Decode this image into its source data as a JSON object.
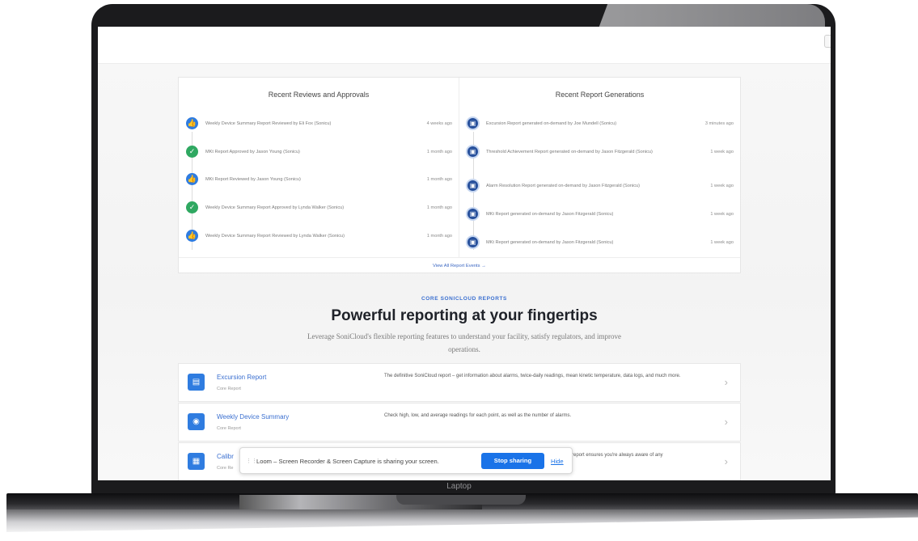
{
  "device": {
    "label": "Laptop"
  },
  "reviews": {
    "title": "Recent Reviews and Approvals",
    "items": [
      {
        "icon": "thumbs-up-icon",
        "text": "Weekly Device Summary Report Reviewed by Eli Fox (Sonicu)",
        "time": "4 weeks ago"
      },
      {
        "icon": "check-icon",
        "text": "MKt Report Approved by Jason Young (Sonicu)",
        "time": "1 month ago"
      },
      {
        "icon": "thumbs-up-icon",
        "text": "MKt Report Reviewed by Jason Young (Sonicu)",
        "time": "1 month ago"
      },
      {
        "icon": "check-icon",
        "text": "Weekly Device Summary Report Approved by Lynda Walker (Sonicu)",
        "time": "1 month ago"
      },
      {
        "icon": "thumbs-up-icon",
        "text": "Weekly Device Summary Report Reviewed by Lynda Walker (Sonicu)",
        "time": "1 month ago"
      }
    ]
  },
  "generations": {
    "title": "Recent Report Generations",
    "items": [
      {
        "icon": "report-icon",
        "text": "Excursion Report generated on-demand by Joe Mundell (Sonicu)",
        "time": "3 minutes ago"
      },
      {
        "icon": "report-icon",
        "text": "Threshold Achievement Report generated on-demand by Jason Fitzgerald (Sonicu)",
        "time": "1 week ago"
      },
      {
        "icon": "report-icon",
        "text": "Alarm Resolution Report generated on-demand by Jason Fitzgerald (Sonicu)",
        "time": "1 week ago"
      },
      {
        "icon": "report-icon",
        "text": "MKt Report generated on-demand by Jason Fitzgerald (Sonicu)",
        "time": "1 week ago"
      },
      {
        "icon": "report-icon",
        "text": "MKt Report generated on-demand by Jason Fitzgerald (Sonicu)",
        "time": "1 week ago"
      }
    ]
  },
  "view_all": "View All Report Events →",
  "section": {
    "eyebrow": "CORE SONICLOUD REPORTS",
    "headline": "Powerful reporting at your fingertips",
    "sub": "Leverage SoniCloud's flexible reporting features to understand your facility, satisfy regulators, and improve operations."
  },
  "cards": [
    {
      "icon": "clipboard-icon",
      "title": "Excursion Report",
      "subtitle": "Core Report",
      "desc": "The definitive SoniCloud report – get information about alarms, twice-daily readings, mean kinetic temperature, data logs, and much more."
    },
    {
      "icon": "device-icon",
      "title": "Weekly Device Summary",
      "subtitle": "Core Report",
      "desc": "Check high, low, and average readings for each point, as well as the number of alarms."
    },
    {
      "icon": "calibration-icon",
      "title": "Calibr",
      "subtitle": "Core Re",
      "desc": "report ensures you're always aware of any"
    }
  ],
  "loom": {
    "text": "Loom – Screen Recorder & Screen Capture is sharing your screen.",
    "stop_label": "Stop sharing",
    "hide_label": "Hide"
  },
  "colors": {
    "accent": "#2f7ce0",
    "success": "#2fa861",
    "report": "#27509c",
    "loom_button": "#1a73e8"
  }
}
